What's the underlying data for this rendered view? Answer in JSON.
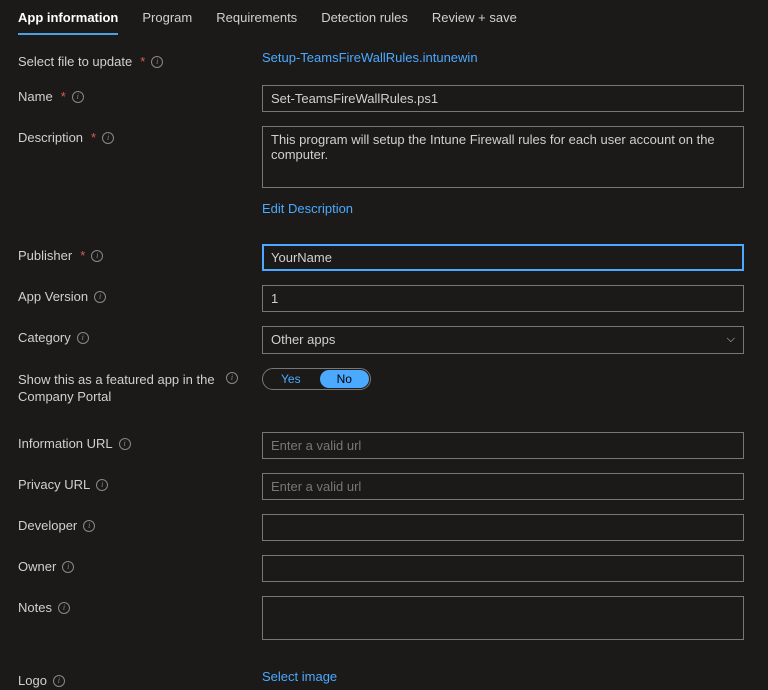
{
  "tabs": {
    "app_info": "App information",
    "program": "Program",
    "requirements": "Requirements",
    "detection": "Detection rules",
    "review": "Review + save"
  },
  "fields": {
    "select_file_label": "Select file to update",
    "select_file_link": "Setup-TeamsFireWallRules.intunewin",
    "name_label": "Name",
    "name_value": "Set-TeamsFireWallRules.ps1",
    "description_label": "Description",
    "description_value": "This program will setup the Intune Firewall rules for each user account on the computer.",
    "edit_description_link": "Edit Description",
    "publisher_label": "Publisher",
    "publisher_value": "YourName",
    "app_version_label": "App Version",
    "app_version_value": "1",
    "category_label": "Category",
    "category_value": "Other apps",
    "featured_label": "Show this as a featured app in the Company Portal",
    "toggle_yes": "Yes",
    "toggle_no": "No",
    "info_url_label": "Information URL",
    "info_url_placeholder": "Enter a valid url",
    "privacy_url_label": "Privacy URL",
    "privacy_url_placeholder": "Enter a valid url",
    "developer_label": "Developer",
    "owner_label": "Owner",
    "notes_label": "Notes",
    "logo_label": "Logo",
    "logo_link": "Select image"
  }
}
